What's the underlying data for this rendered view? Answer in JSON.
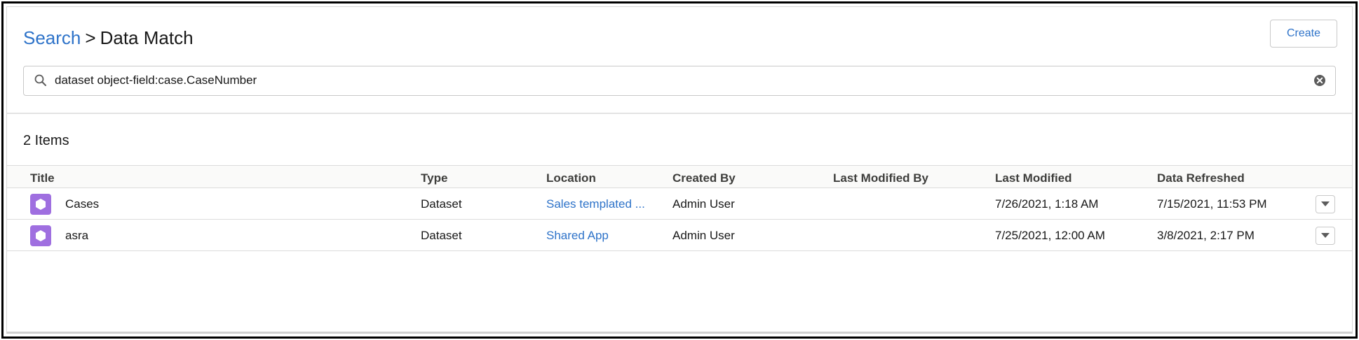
{
  "header": {
    "breadcrumb_link": "Search",
    "breadcrumb_sep": ">",
    "breadcrumb_current": "Data Match",
    "create_label": "Create"
  },
  "search": {
    "value": "dataset object-field:case.CaseNumber",
    "icon": "search-icon",
    "clear_icon": "clear-icon"
  },
  "results": {
    "count_label": "2 Items",
    "columns": [
      "Title",
      "Type",
      "Location",
      "Created By",
      "Last Modified By",
      "Last Modified",
      "Data Refreshed"
    ],
    "rows": [
      {
        "title": "Cases",
        "type": "Dataset",
        "location": "Sales templated ...",
        "created_by": "Admin User",
        "last_modified_by": "",
        "last_modified": "7/26/2021, 1:18 AM",
        "data_refreshed": "7/15/2021, 11:53 PM"
      },
      {
        "title": "asra",
        "type": "Dataset",
        "location": "Shared App",
        "created_by": "Admin User",
        "last_modified_by": "",
        "last_modified": "7/25/2021, 12:00 AM",
        "data_refreshed": "3/8/2021, 2:17 PM"
      }
    ]
  },
  "colors": {
    "link": "#2e73c9",
    "dataset_icon": "#9f6fe0",
    "border": "#dcdcdc"
  }
}
